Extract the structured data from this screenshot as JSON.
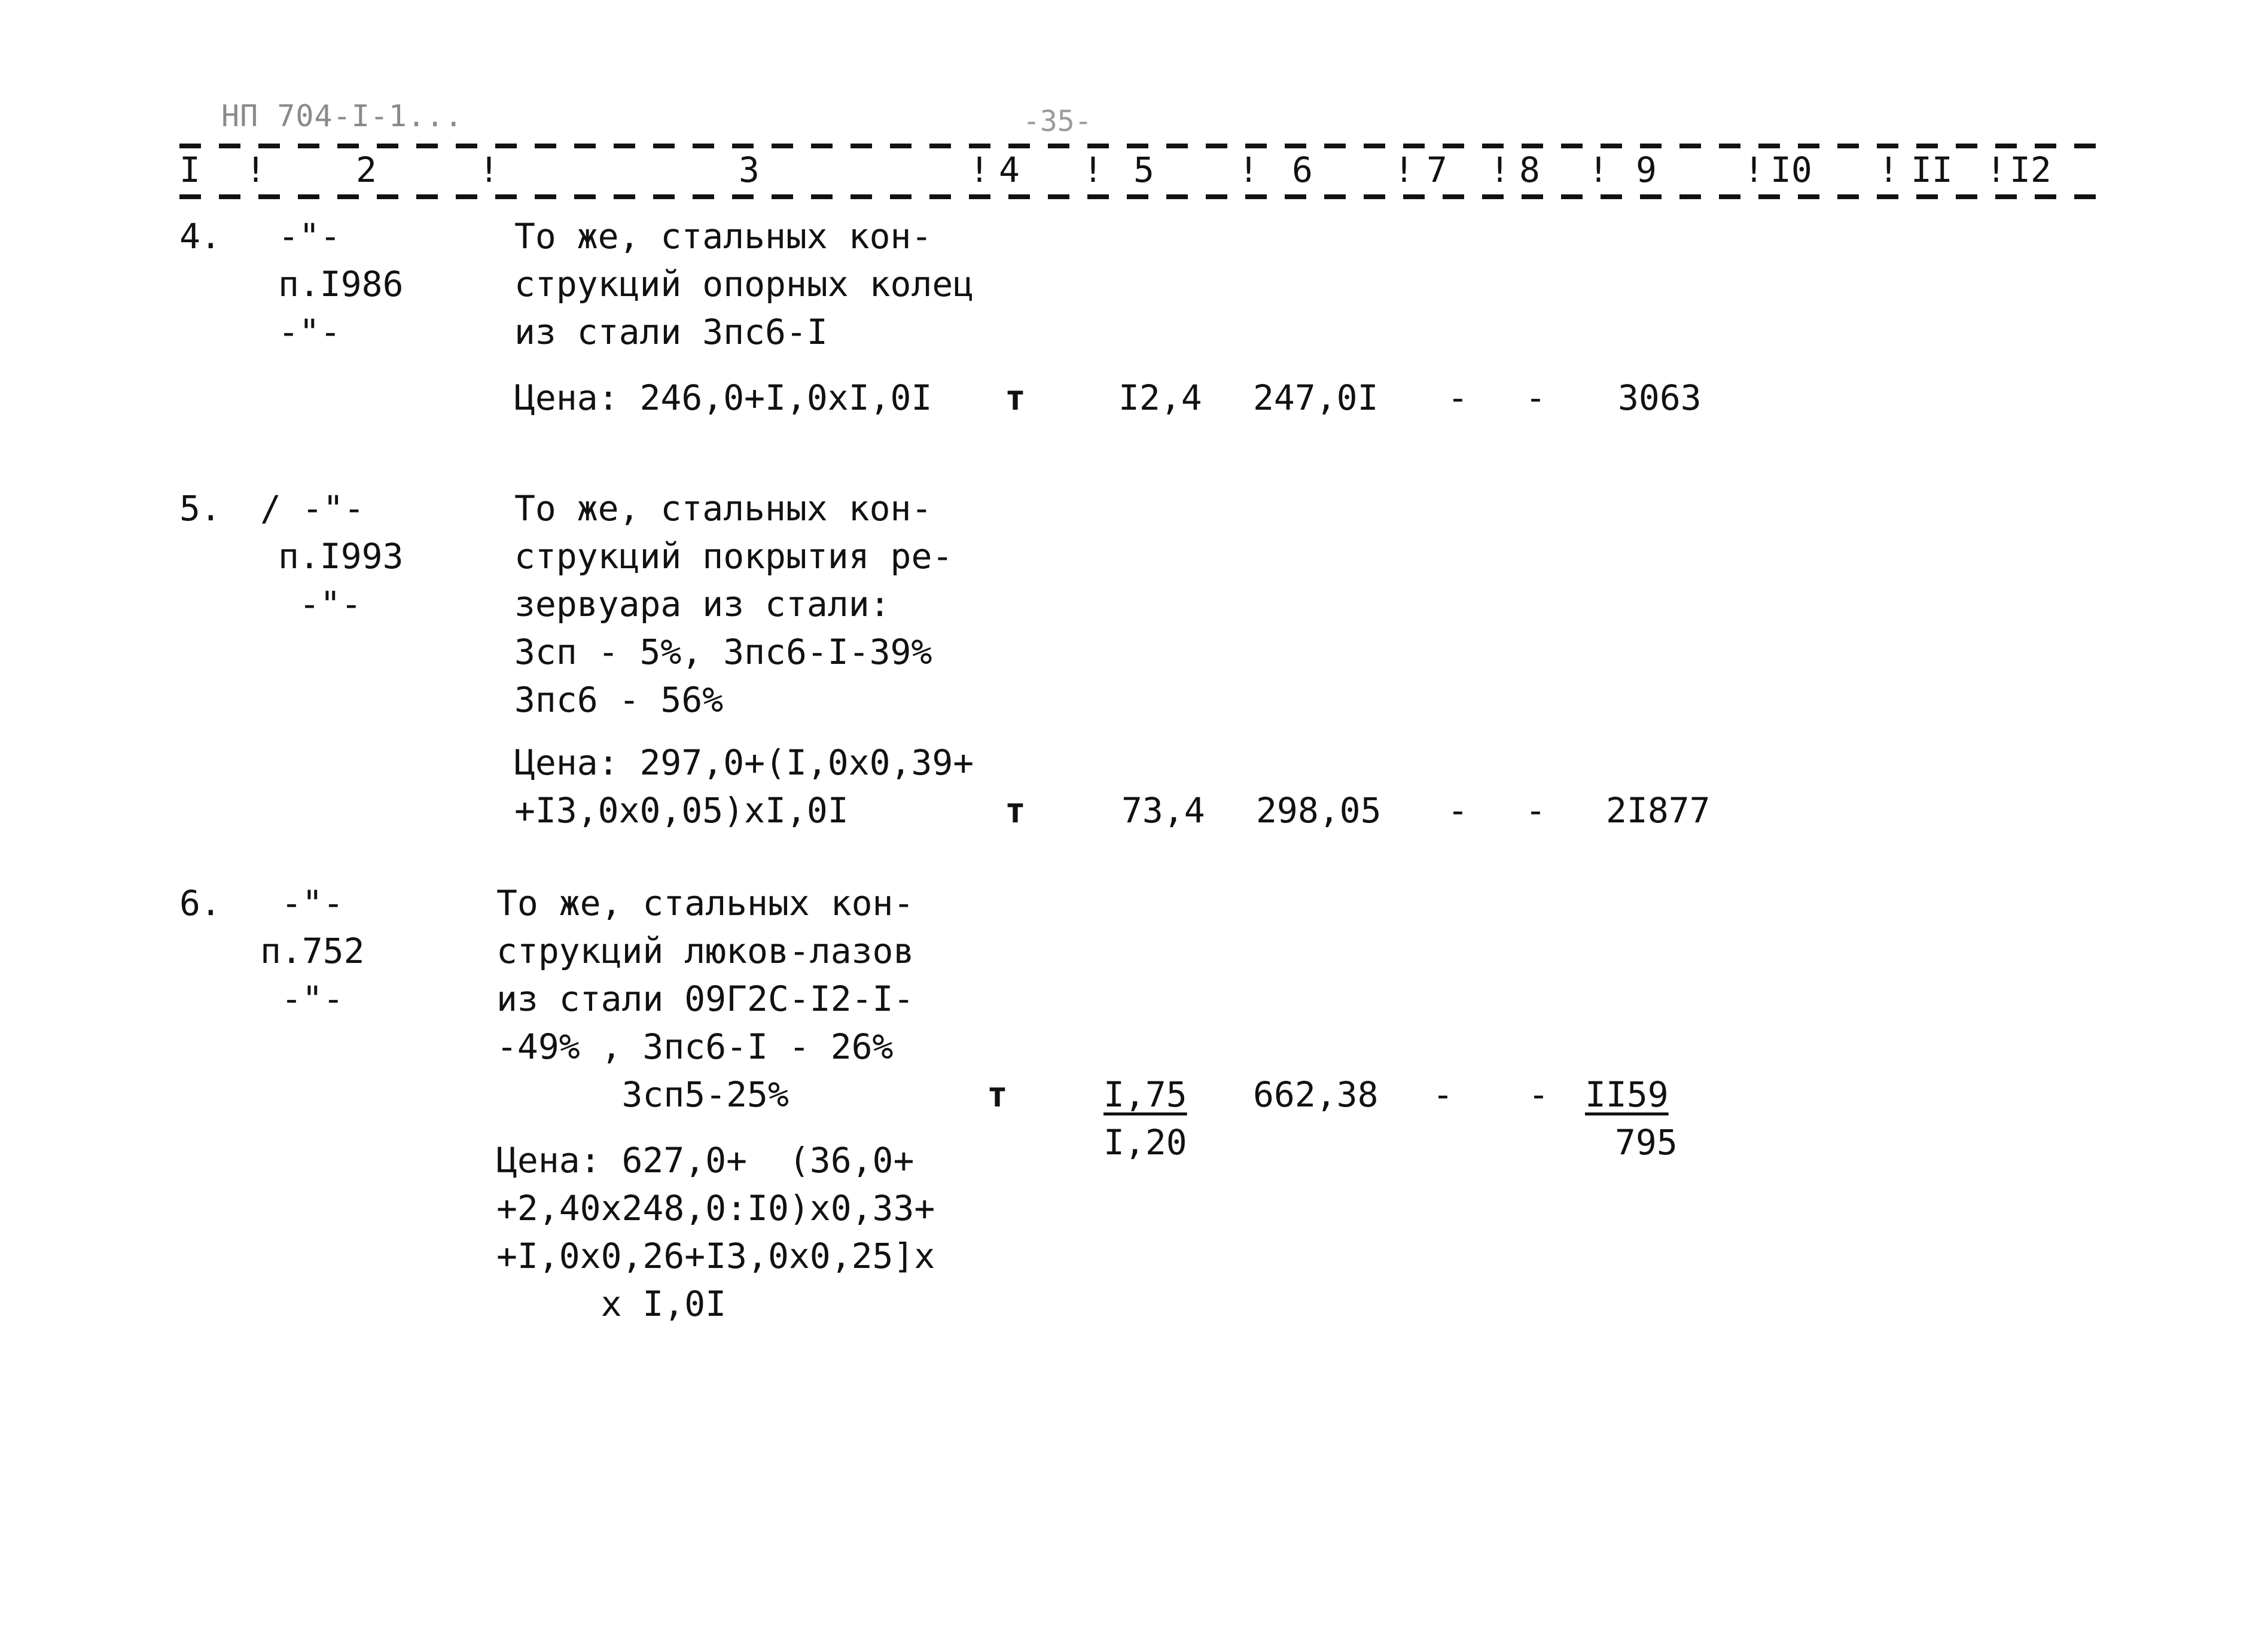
{
  "header": {
    "doc_code": "НП 704-I-1...",
    "page_number": "-35-",
    "columns": [
      "I",
      "2",
      "3",
      "4",
      "5",
      "6",
      "7",
      "8",
      "9",
      "I0",
      "II",
      "I2"
    ]
  },
  "rows": [
    {
      "num": "4.",
      "ref": [
        "-\"-",
        "п.I986",
        "-\"-"
      ],
      "desc": [
        "То же, стальных кон-",
        "струкций опорных колец",
        "из стали 3пс6-I"
      ],
      "price": [
        "Цена: 246,0+I,0xI,0I"
      ],
      "unit": "т",
      "qty": [
        "I2,4"
      ],
      "unit_price": "247,0I",
      "col7": "-",
      "col8": "-",
      "total": [
        "3063"
      ]
    },
    {
      "num": "5.",
      "ref": [
        "/ -\"-",
        "п.I993",
        "-\"-"
      ],
      "desc": [
        "То же, стальных кон-",
        "струкций покрытия ре-",
        "зервуара из стали:",
        "3сп - 5%, 3пс6-I-39%",
        "3пс6 - 56%"
      ],
      "price": [
        "Цена: 297,0+(I,0x0,39+",
        "+I3,0x0,05)xI,0I"
      ],
      "unit": "т",
      "qty": [
        "73,4"
      ],
      "unit_price": "298,05",
      "col7": "-",
      "col8": "-",
      "total": [
        "2I877"
      ]
    },
    {
      "num": "6.",
      "ref": [
        "-\"-",
        "п.752",
        "-\"-"
      ],
      "desc": [
        "То же, стальных кон-",
        "струкций люков-лазов",
        "из стали 09Г2С-I2-I-",
        "-49% , 3пс6-I - 26%",
        "      3сп5-25%"
      ],
      "price": [
        "Цена: 627,0+  (36,0+",
        "+2,40x248,0:I0)x0,33+",
        "+I,0x0,26+I3,0x0,25]x",
        "     x I,0I"
      ],
      "unit": "т",
      "qty": [
        "I,75",
        "I,20"
      ],
      "unit_price": "662,38",
      "col7": "-",
      "col8": "-",
      "total": [
        "II59",
        "795"
      ]
    }
  ]
}
